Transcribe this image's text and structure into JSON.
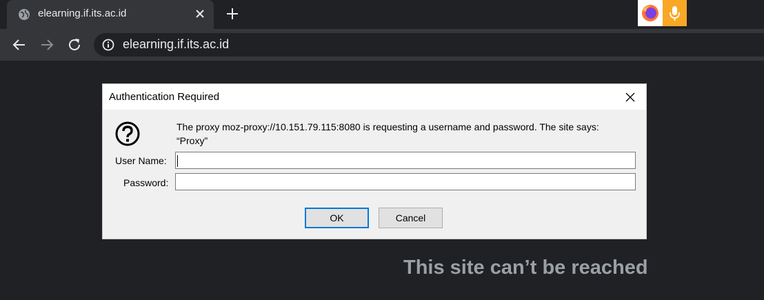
{
  "browser": {
    "tab": {
      "title": "elearning.if.its.ac.id",
      "favicon": "globe-icon"
    },
    "new_tab_icon": "plus-icon",
    "extensions": [
      "firefox-icon",
      "microphone-icon"
    ],
    "toolbar": {
      "back_icon": "arrow-left-icon",
      "forward_icon": "arrow-right-icon",
      "reload_icon": "reload-icon",
      "info_icon": "info-icon",
      "url": "elearning.if.its.ac.id"
    }
  },
  "page": {
    "error_title": "This site can’t be reached"
  },
  "dialog": {
    "title": "Authentication Required",
    "message": "The proxy moz-proxy://10.151.79.115:8080 is requesting a username and password. The site says: “Proxy”",
    "username_label": "User Name:",
    "password_label": "Password:",
    "username_value": "",
    "password_value": "",
    "ok_label": "OK",
    "cancel_label": "Cancel"
  },
  "colors": {
    "background": "#202124",
    "toolbar": "#35363a",
    "dialog": "#f0f0f0",
    "focus_border": "#0078d7",
    "extension_accent": "#f9a825"
  }
}
